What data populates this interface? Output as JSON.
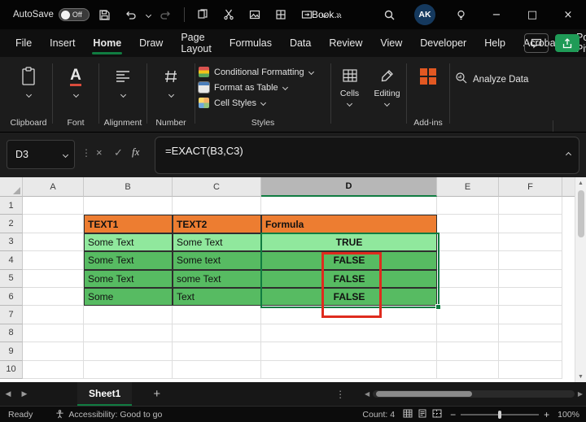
{
  "colors": {
    "accent_green": "#107C41",
    "tab_green": "#21A366",
    "orange_fill": "#ED7D31",
    "light_green_fill": "#90E89D",
    "green_fill": "#57BB62",
    "annotation_red": "#DF2B1E",
    "avatar_bg": "#15395E",
    "share_green": "#1F9B57"
  },
  "glyphs": {
    "overflow": "»",
    "dots_vertical": "⋮",
    "left": "◀",
    "right": "▶",
    "up": "▲",
    "down": "▼",
    "check": "✓",
    "close_x": "×",
    "plus": "+",
    "minus": "−",
    "maximize": "□",
    "minimize": "−"
  },
  "titlebar": {
    "autosave_label": "AutoSave",
    "autosave_state": "Off",
    "doc_title": "Book...",
    "avatar_initials": "AK"
  },
  "menubar": {
    "items": [
      "File",
      "Insert",
      "Home",
      "Draw",
      "Page Layout",
      "Formulas",
      "Data",
      "Review",
      "View",
      "Developer",
      "Help",
      "Acrobat",
      "Power Pivot"
    ],
    "active_index": 2
  },
  "ribbon": {
    "collapsed_groups": [
      "Clipboard",
      "Font",
      "Alignment",
      "Number"
    ],
    "styles_items": [
      "Conditional Formatting",
      "Format as Table",
      "Cell Styles"
    ],
    "styles_label": "Styles",
    "cells_label": "Cells",
    "editing_label": "Editing",
    "addins_label": "Add-ins",
    "analyze_data_label": "Analyze Data",
    "font_glyph": "A"
  },
  "formula_bar": {
    "name_box": "D3",
    "fx_label": "fx",
    "formula": "=EXACT(B3,C3)"
  },
  "grid": {
    "columns": [
      "A",
      "B",
      "C",
      "D",
      "E",
      "F"
    ],
    "selected_column": "D",
    "rows": [
      "1",
      "2",
      "3",
      "4",
      "5",
      "6",
      "7",
      "8",
      "9",
      "10"
    ],
    "cells": [
      {
        "ref": "B2",
        "text": "TEXT1",
        "style": "header"
      },
      {
        "ref": "C2",
        "text": "TEXT2",
        "style": "header"
      },
      {
        "ref": "D2",
        "text": "Formula",
        "style": "header"
      },
      {
        "ref": "B3",
        "text": "Some Text",
        "style": "light"
      },
      {
        "ref": "C3",
        "text": "Some Text",
        "style": "light"
      },
      {
        "ref": "D3",
        "text": "TRUE",
        "style": "light-center"
      },
      {
        "ref": "B4",
        "text": "Some Text",
        "style": "green"
      },
      {
        "ref": "C4",
        "text": "Some text",
        "style": "green"
      },
      {
        "ref": "D4",
        "text": "FALSE",
        "style": "green-center"
      },
      {
        "ref": "B5",
        "text": "Some Text",
        "style": "green"
      },
      {
        "ref": "C5",
        "text": "some Text",
        "style": "green"
      },
      {
        "ref": "D5",
        "text": "FALSE",
        "style": "green-center"
      },
      {
        "ref": "B6",
        "text": "Some",
        "style": "green"
      },
      {
        "ref": "C6",
        "text": "Text",
        "style": "green"
      },
      {
        "ref": "D6",
        "text": "FALSE",
        "style": "green-center"
      }
    ],
    "selection": {
      "range": "D3:D6"
    },
    "annotation": {
      "range": "D4:D6"
    }
  },
  "tabbar": {
    "sheets": [
      "Sheet1"
    ],
    "active_sheet": "Sheet1"
  },
  "statusbar": {
    "mode": "Ready",
    "accessibility": "Accessibility: Good to go",
    "count": "Count: 4",
    "zoom": "100%"
  }
}
